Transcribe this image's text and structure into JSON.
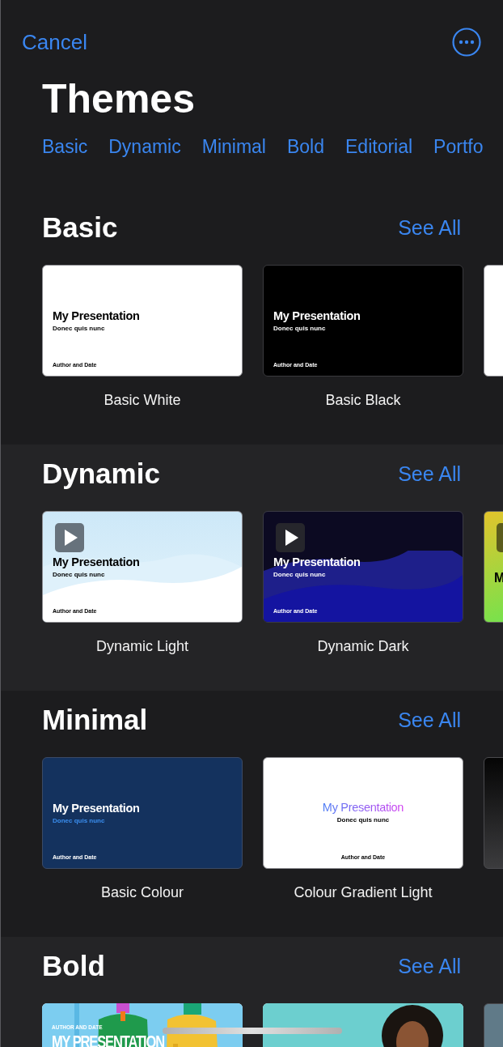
{
  "nav": {
    "cancel": "Cancel"
  },
  "title": "Themes",
  "categories": [
    {
      "label": "Basic"
    },
    {
      "label": "Dynamic"
    },
    {
      "label": "Minimal"
    },
    {
      "label": "Bold"
    },
    {
      "label": "Editorial"
    },
    {
      "label": "Portfo"
    }
  ],
  "sections": [
    {
      "heading": "Basic",
      "see_all": "See All",
      "themes": [
        {
          "name": "Basic White",
          "kind": "white",
          "title": "My Presentation",
          "subtitle": "Donec quis nunc",
          "author": "Author and Date",
          "play_button": false
        },
        {
          "name": "Basic Black",
          "kind": "black",
          "title": "My Presentation",
          "subtitle": "Donec quis nunc",
          "author": "Author and Date",
          "play_button": false
        },
        {
          "kind": "white",
          "play_button": false
        }
      ]
    },
    {
      "heading": "Dynamic",
      "see_all": "See All",
      "themes": [
        {
          "name": "Dynamic Light",
          "kind": "dynamic-light",
          "title": "My Presentation",
          "subtitle": "Donec quis nunc",
          "author": "Author and Date",
          "play_button": true
        },
        {
          "name": "Dynamic Dark",
          "kind": "dynamic-dark",
          "title": "My Presentation",
          "subtitle": "Donec quis nunc",
          "author": "Author and Date",
          "play_button": true
        },
        {
          "kind": "lime",
          "title": "M",
          "play_button": true
        }
      ]
    },
    {
      "heading": "Minimal",
      "see_all": "See All",
      "themes": [
        {
          "name": "Basic Colour",
          "kind": "colour",
          "title": "My Presentation",
          "subtitle": "Donec quis nunc",
          "author": "Author and Date",
          "play_button": false
        },
        {
          "name": "Colour Gradient Light",
          "kind": "gradient",
          "title": "My Presentation",
          "subtitle": "Donec quis nunc",
          "author": "Author and Date",
          "play_button": false
        },
        {
          "kind": "dark-gradient",
          "play_button": false
        }
      ]
    },
    {
      "heading": "Bold",
      "see_all": "See All",
      "themes": [
        {
          "kind": "photo-people",
          "author": "AUTHOR AND DATE",
          "title": "MY PRESENTATION",
          "play_button": false
        },
        {
          "kind": "photo-portrait",
          "play_button": false
        },
        {
          "kind": "slate",
          "play_button": false
        }
      ]
    }
  ]
}
